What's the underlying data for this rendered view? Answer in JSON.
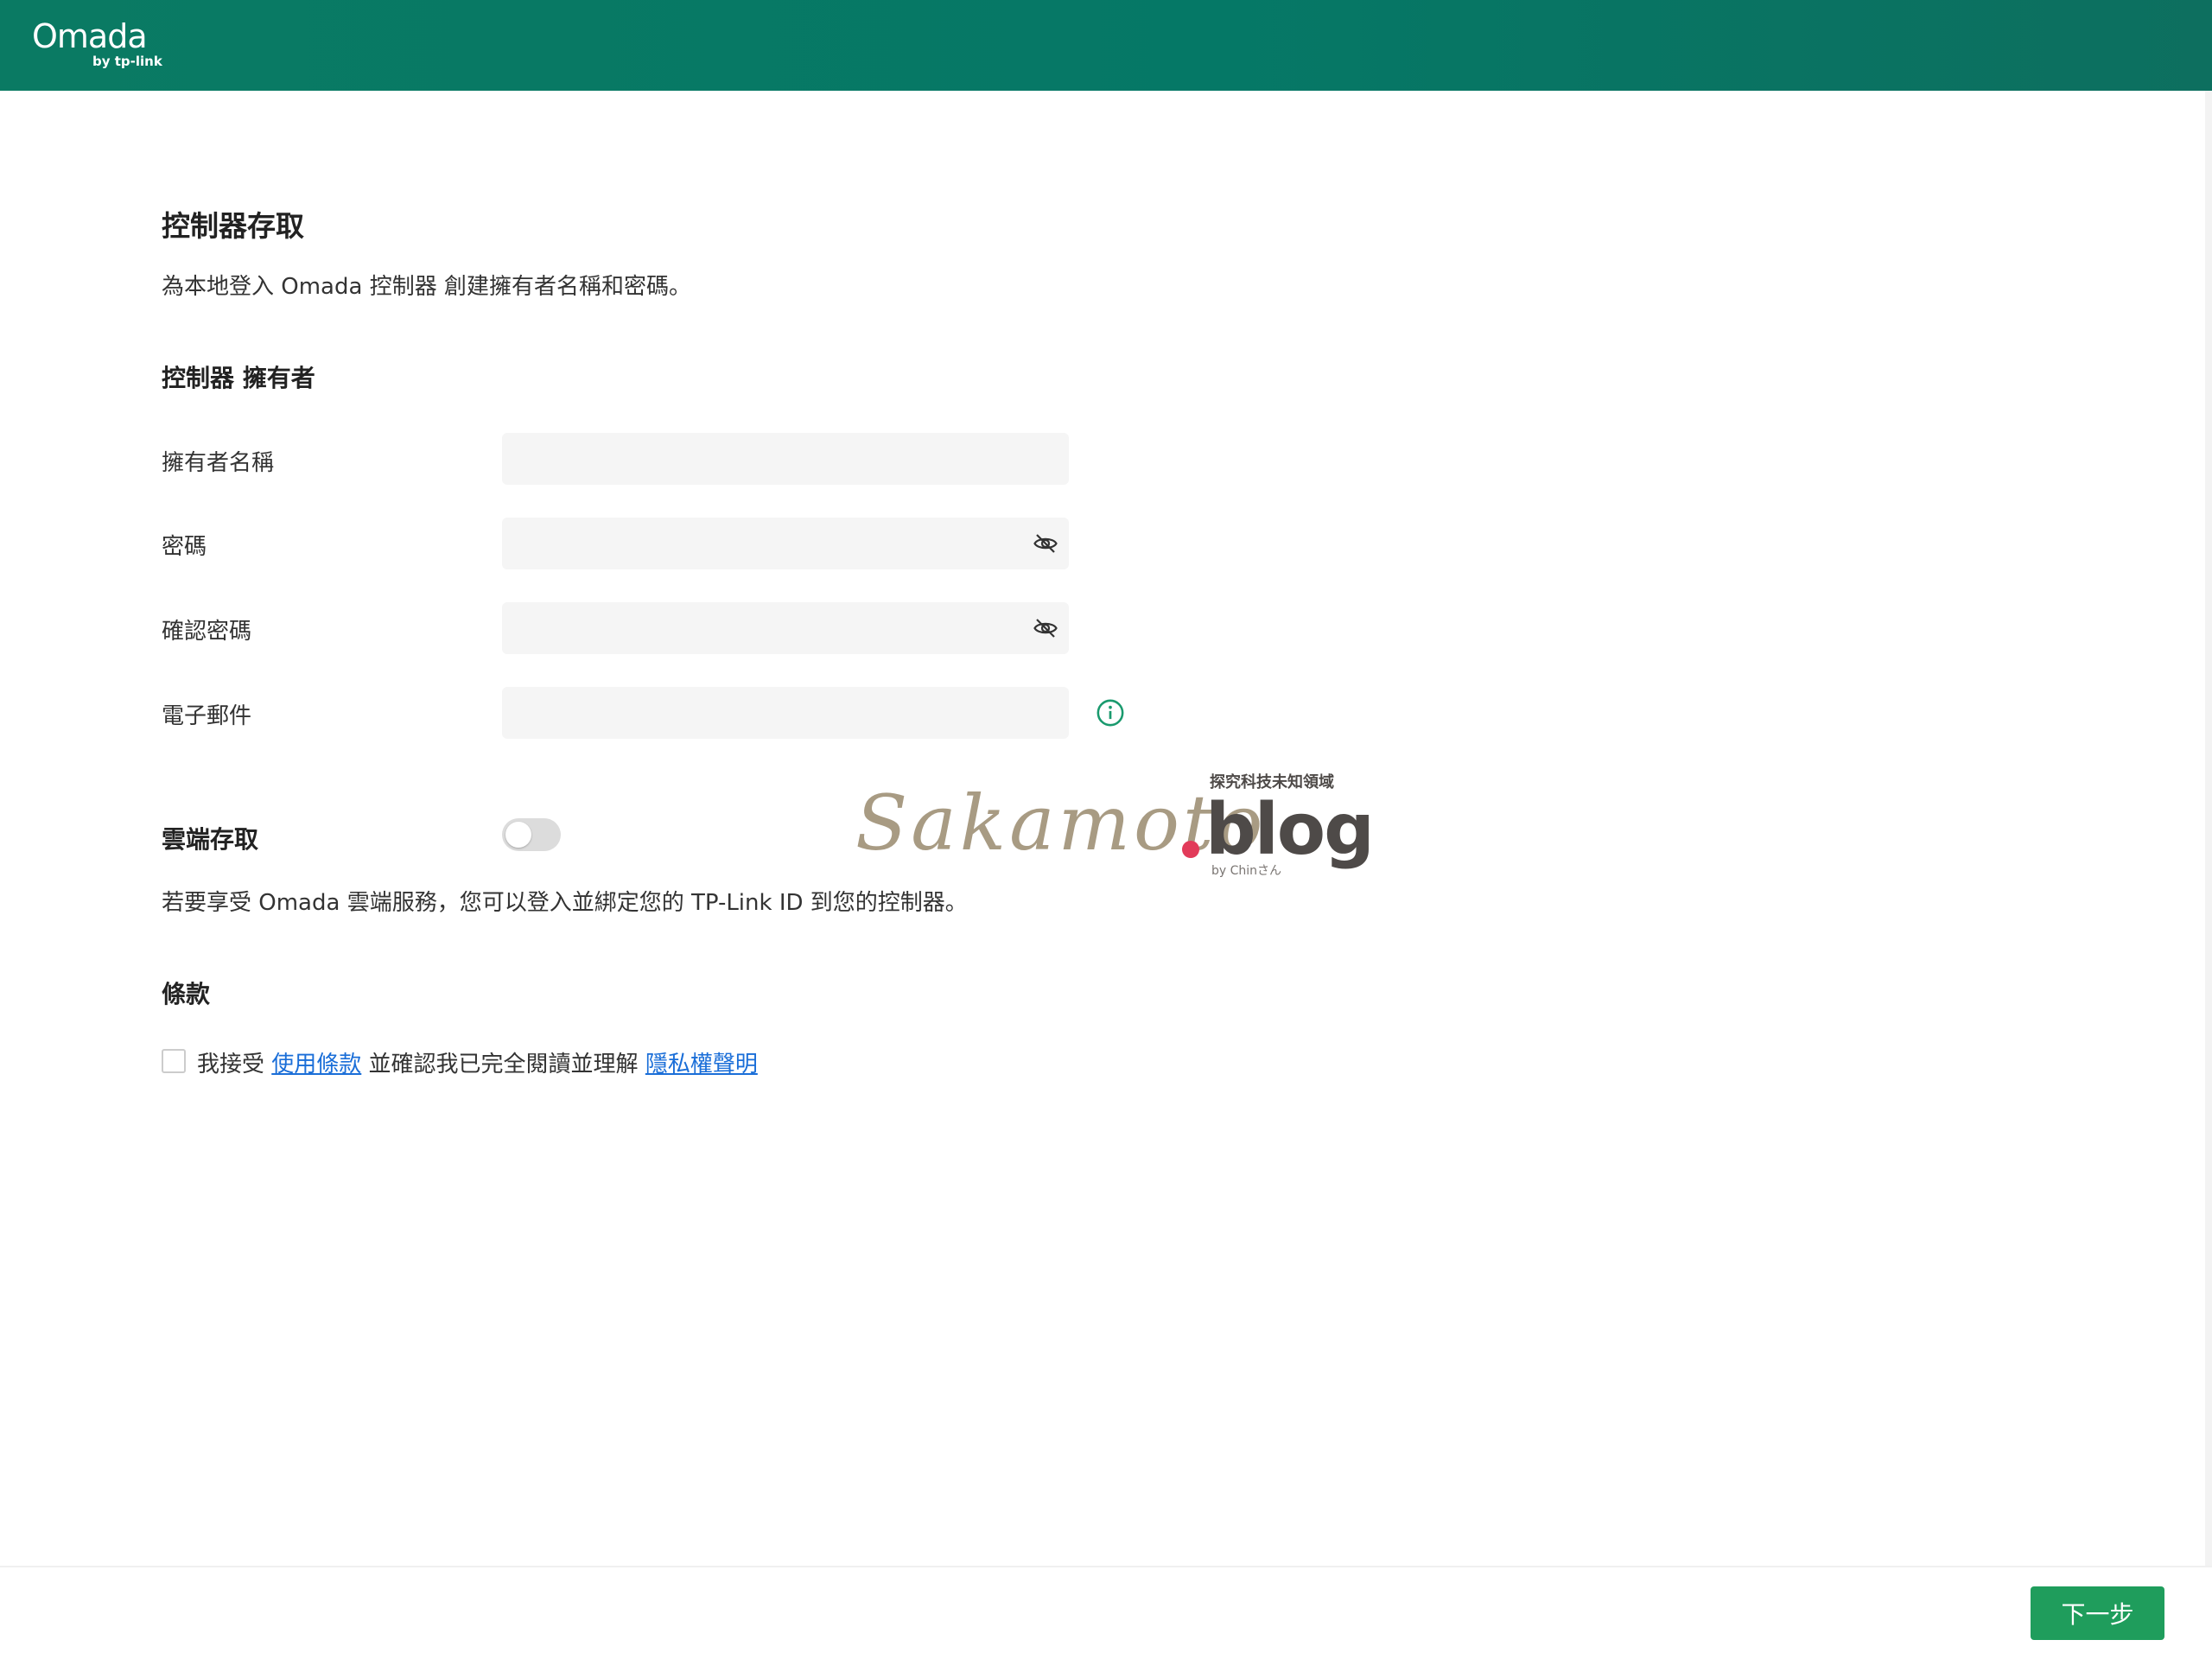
{
  "header": {
    "logo_text": "Omada",
    "logo_sub": "by tp-link",
    "background": "#0a7a63"
  },
  "page": {
    "title": "控制器存取",
    "description": "為本地登入 Omada 控制器 創建擁有者名稱和密碼。"
  },
  "owner_section": {
    "heading": "控制器 擁有者",
    "fields": [
      {
        "label": "擁有者名稱",
        "value": "",
        "icon": ""
      },
      {
        "label": "密碼",
        "value": "",
        "icon": "eye-slash-icon"
      },
      {
        "label": "確認密碼",
        "value": "",
        "icon": "eye-slash-icon"
      },
      {
        "label": "電子郵件",
        "value": "",
        "icon": "info-icon"
      }
    ]
  },
  "cloud": {
    "label": "雲端存取",
    "enabled": false,
    "description": "若要享受 Omada 雲端服務，您可以登入並綁定您的 TP-Link ID 到您的控制器。"
  },
  "terms": {
    "heading": "條款",
    "checked": false,
    "prefix": "我接受 ",
    "terms_link": "使用條款",
    "middle": " 並確認我已完全閱讀並理解 ",
    "privacy_link": "隱私權聲明"
  },
  "footer": {
    "next_label": "下一步",
    "accent": "#1f9d5c"
  },
  "watermark": {
    "script_text": "Sakamoto",
    "blog_text": "blog",
    "tagline": "探究科技未知領域",
    "by_line": "by Chinさん"
  }
}
